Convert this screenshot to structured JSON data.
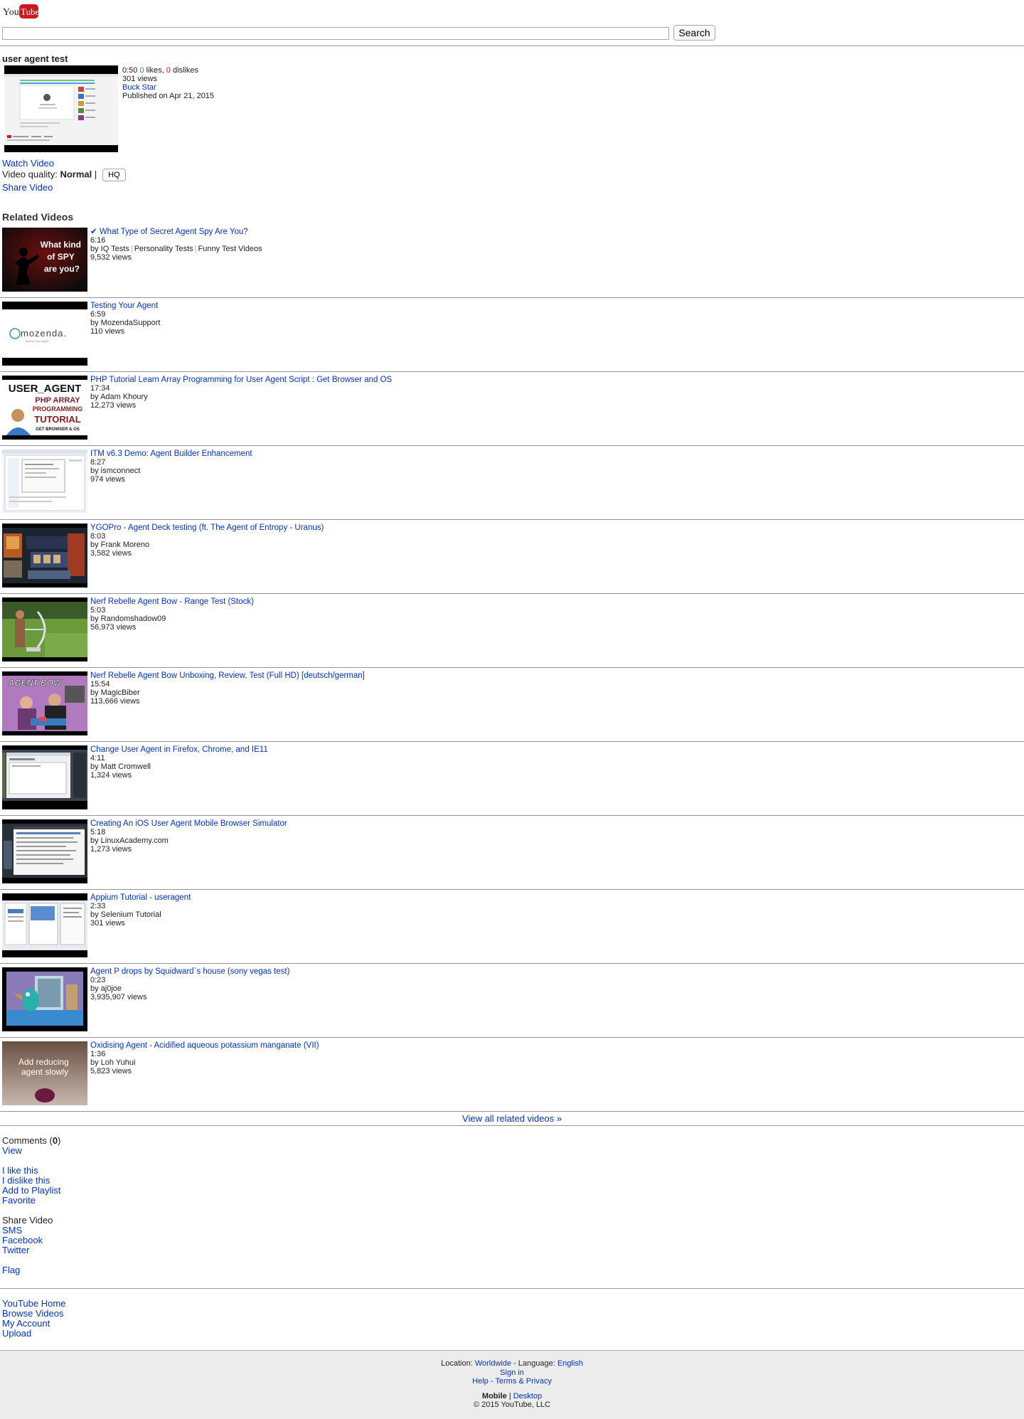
{
  "logo": {
    "you": "You",
    "tube": "Tube"
  },
  "search": {
    "value": "",
    "placeholder": "",
    "button_label": "Search"
  },
  "video": {
    "title": "user agent test",
    "duration": "0:50",
    "likes_count": "0",
    "likes_label": "likes,",
    "dislikes_count": "0",
    "dislikes_label": "dislikes",
    "views": "301 views",
    "author": "Buck Star",
    "published": "Published on Apr 21, 2015",
    "watch_label": "Watch Video",
    "quality_label": "Video quality:",
    "quality_value": "Normal",
    "quality_sep": "|",
    "hq_label": "HQ",
    "share_label": "Share Video"
  },
  "related": {
    "title": "Related Videos",
    "view_all": "View all related videos »",
    "items": [
      {
        "title": "✔ What Type of Secret Agent Spy Are You?",
        "duration": "6:16",
        "by": "by IQ Tests",
        "extra1": "Personality Tests",
        "extra2": "Funny Test Videos",
        "views": "9,532 views",
        "thumb_text": "What kind of SPY are you?"
      },
      {
        "title": "Testing Your Agent",
        "duration": "6:59",
        "by": "by MozendaSupport",
        "views": "110 views",
        "thumb_text": "mozenda.",
        "thumb_sub": "Testing Your Agent"
      },
      {
        "title": "PHP Tutorial Learn Array Programming for User Agent Script : Get Browser and OS",
        "duration": "17:34",
        "by": "by Adam Khoury",
        "views": "12,273 views",
        "thumb_l1": "USER_AGENT",
        "thumb_l2": "PHP ARRAY",
        "thumb_l3": "PROGRAMMING",
        "thumb_l4": "TUTORIAL",
        "thumb_l5": "GET BROWSER & OS"
      },
      {
        "title": "ITM v6.3 Demo: Agent Builder Enhancement",
        "duration": "8:27",
        "by": "by ismconnect",
        "views": "974 views"
      },
      {
        "title": "YGOPro - Agent Deck testing (ft. The Agent of Entropy - Uranus)",
        "duration": "8:03",
        "by": "by Frank Moreno",
        "views": "3,582 views"
      },
      {
        "title": "Nerf Rebelle Agent Bow - Range Test (Stock)",
        "duration": "5:03",
        "by": "by Randomshadow09",
        "views": "56,973 views"
      },
      {
        "title": "Nerf Rebelle Agent Bow Unboxing, Review, Test (Full HD) [deutsch/german]",
        "duration": "15:54",
        "by": "by MagicBiber",
        "views": "113,666 views",
        "thumb_text": "AGENT BOW"
      },
      {
        "title": "Change User Agent in Firefox, Chrome, and IE11",
        "duration": "4:11",
        "by": "by Matt Cromwell",
        "views": "1,324 views"
      },
      {
        "title": "Creating An iOS User Agent Mobile Browser Simulator",
        "duration": "5:18",
        "by": "by LinuxAcademy.com",
        "views": "1,273 views"
      },
      {
        "title": "Appium Tutorial - useragent",
        "duration": "2:33",
        "by": "by Selenium Tutorial",
        "views": "301 views"
      },
      {
        "title": "Agent P drops by Squidward`s house (sony vegas test)",
        "duration": "0:23",
        "by": "by aj0joe",
        "views": "3,935,907 views"
      },
      {
        "title": "Oxidising Agent - Acidified aqueous potassium manganate (VII)",
        "duration": "1:36",
        "by": "by Loh Yuhui",
        "views": "5,823 views",
        "thumb_text": "Add reducing agent slowly"
      }
    ]
  },
  "comments": {
    "label": "Comments",
    "count": "0",
    "view": "View"
  },
  "actions": {
    "like": "I like this",
    "dislike": "I dislike this",
    "playlist": "Add to Playlist",
    "favorite": "Favorite"
  },
  "share": {
    "label": "Share Video",
    "sms": "SMS",
    "facebook": "Facebook",
    "twitter": "Twitter"
  },
  "flag": "Flag",
  "nav": {
    "home": "YouTube Home",
    "browse": "Browse Videos",
    "account": "My Account",
    "upload": "Upload"
  },
  "footer": {
    "location_label": "Location:",
    "location_value": "Worldwide",
    "language_label": "- Language:",
    "language_value": "English",
    "sign_in": "Sign in",
    "help": "Help",
    "dash": "-",
    "terms": "Terms & Privacy",
    "mobile": "Mobile",
    "pipe": "|",
    "desktop": "Desktop",
    "copyright": "© 2015 YouTube, LLC"
  },
  "colors": {
    "link": "#0033cc",
    "logo_red": "#cc181e",
    "likes": "#26a626",
    "dislikes": "#d82020",
    "footer_bg": "#ececec"
  }
}
